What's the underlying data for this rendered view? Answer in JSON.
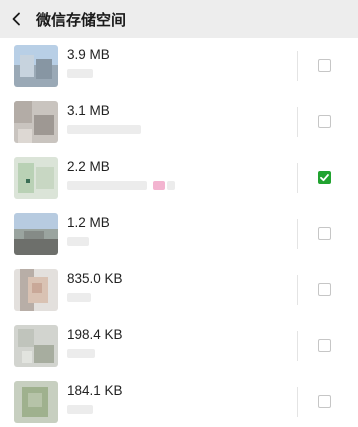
{
  "header": {
    "back_icon": "chevron-left-icon",
    "title": "微信存储空间"
  },
  "accent_color": "#21a330",
  "items": [
    {
      "size": "3.9 MB",
      "checked": false
    },
    {
      "size": "3.1 MB",
      "checked": false
    },
    {
      "size": "2.2 MB",
      "checked": true
    },
    {
      "size": "1.2 MB",
      "checked": false
    },
    {
      "size": "835.0 KB",
      "checked": false
    },
    {
      "size": "198.4 KB",
      "checked": false
    },
    {
      "size": "184.1 KB",
      "checked": false
    }
  ]
}
